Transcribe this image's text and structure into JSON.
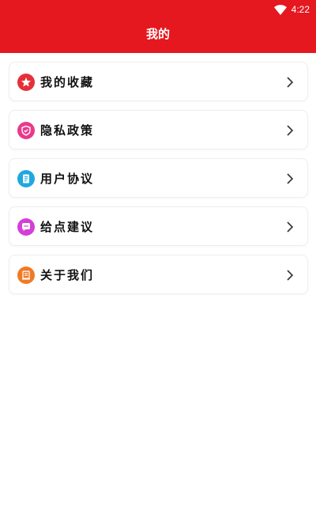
{
  "status_bar": {
    "time": "4:22",
    "wifi_icon": "wifi-icon"
  },
  "header": {
    "title": "我的",
    "background": "#e5171f"
  },
  "menu": {
    "items": [
      {
        "label": "我的收藏",
        "icon": "star-icon",
        "color": "#e5303a"
      },
      {
        "label": "隐私政策",
        "icon": "shield-icon",
        "color": "#e83a8a"
      },
      {
        "label": "用户协议",
        "icon": "document-icon",
        "color": "#1fa8e0"
      },
      {
        "label": "给点建议",
        "icon": "message-icon",
        "color": "#d43fd6"
      },
      {
        "label": "关于我们",
        "icon": "info-card-icon",
        "color": "#f07a25"
      }
    ]
  }
}
